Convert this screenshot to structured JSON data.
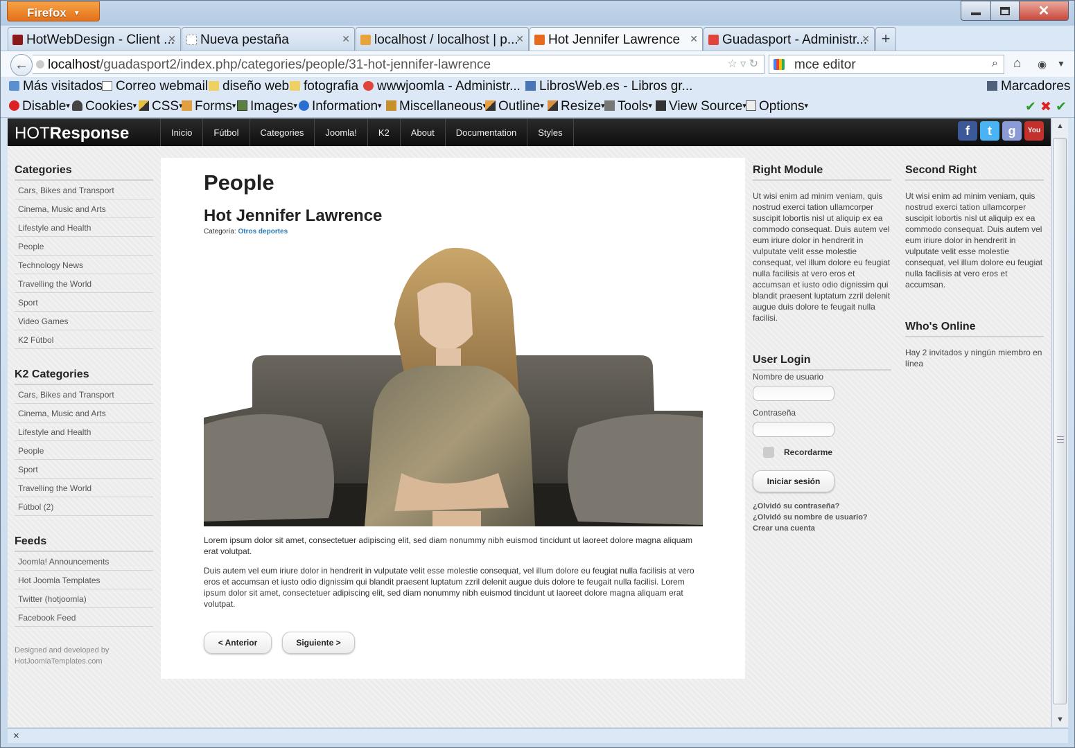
{
  "browser": {
    "app_button": "Firefox",
    "tabs": [
      {
        "title": "HotWebDesign - Client ...",
        "color": "#8b1a1a"
      },
      {
        "title": "Nueva pestaña",
        "color": "#ffffff"
      },
      {
        "title": "localhost / localhost | p...",
        "color": "#e8a33d"
      },
      {
        "title": "Hot Jennifer Lawrence",
        "color": "#e86a1e"
      },
      {
        "title": "Guadasport - Administr...",
        "color": "#e0443a"
      }
    ],
    "url_host": "localhost",
    "url_path": "/guadasport2/index.php/categories/people/31-hot-jennifer-lawrence",
    "search_value": "mce editor",
    "bookmarks": [
      "Más visitados",
      "Correo webmail",
      "diseño web",
      "fotografia",
      "wwwjoomla - Administr...",
      "LibrosWeb.es - Libros gr...",
      "Marcadores"
    ],
    "webdev_toolbar": [
      "Disable",
      "Cookies",
      "CSS",
      "Forms",
      "Images",
      "Information",
      "Miscellaneous",
      "Outline",
      "Resize",
      "Tools",
      "View Source",
      "Options"
    ],
    "status": "×"
  },
  "site": {
    "logo_light": "HOT",
    "logo_bold": "Response",
    "menu": [
      "Inicio",
      "Fútbol",
      "Categories",
      "Joomla!",
      "K2",
      "About",
      "Documentation",
      "Styles"
    ],
    "social": [
      "facebook-icon",
      "twitter-icon",
      "google-icon",
      "youtube-icon"
    ]
  },
  "sidebar": {
    "categories_title": "Categories",
    "categories": [
      "Cars, Bikes and Transport",
      "Cinema, Music and Arts",
      "Lifestyle and Health",
      "People",
      "Technology News",
      "Travelling the World",
      "Sport",
      "Video Games",
      "K2 Fútbol"
    ],
    "k2_title": "K2 Categories",
    "k2": [
      "Cars, Bikes and Transport",
      "Cinema, Music and Arts",
      "Lifestyle and Health",
      "People",
      "Sport",
      "Travelling the World",
      "Fútbol (2)"
    ],
    "feeds_title": "Feeds",
    "feeds": [
      "Joomla! Announcements",
      "Hot Joomla Templates",
      "Twitter (hotjoomla)",
      "Facebook Feed"
    ],
    "credit_line1": "Designed and developed by",
    "credit_line2": "HotJoomlaTemplates.com"
  },
  "article": {
    "page_heading": "People",
    "title": "Hot Jennifer Lawrence",
    "category_label": "Categoría:",
    "category_link": "Otros deportes",
    "para1": "Lorem ipsum dolor sit amet, consectetuer adipiscing elit, sed diam nonummy nibh euismod tincidunt ut laoreet dolore magna aliquam erat volutpat.",
    "para2": "Duis autem vel eum iriure dolor in hendrerit in vulputate velit esse molestie consequat, vel illum dolore eu feugiat nulla facilisis at vero eros et accumsan et iusto odio dignissim qui blandit praesent luptatum zzril delenit augue duis dolore te feugait nulla facilisi. Lorem ipsum dolor sit amet, consectetuer adipiscing elit, sed diam nonummy nibh euismod tincidunt ut laoreet dolore magna aliquam erat volutpat.",
    "prev": "< Anterior",
    "next": "Siguiente >"
  },
  "right": {
    "module_title": "Right Module",
    "module_text": "Ut wisi enim ad minim veniam, quis nostrud exerci tation ullamcorper suscipit lobortis nisl ut aliquip ex ea commodo consequat. Duis autem vel eum iriure dolor in hendrerit in vulputate velit esse molestie consequat, vel illum dolore eu feugiat nulla facilisis at vero eros et accumsan et iusto odio dignissim qui blandit praesent luptatum zzril delenit augue duis dolore te feugait nulla facilisi.",
    "login_title": "User Login",
    "username_label": "Nombre de usuario",
    "password_label": "Contraseña",
    "remember_label": "Recordarme",
    "login_button": "Iniciar sesión",
    "forgot_password": "¿Olvidó su contraseña?",
    "forgot_username": "¿Olvidó su nombre de usuario?",
    "create_account": "Crear una cuenta"
  },
  "second": {
    "title": "Second Right",
    "text": "Ut wisi enim ad minim veniam, quis nostrud exerci tation ullamcorper suscipit lobortis nisl ut aliquip ex ea commodo consequat. Duis autem vel eum iriure dolor in hendrerit in vulputate velit esse molestie consequat, vel illum dolore eu feugiat nulla facilisis at vero eros et accumsan.",
    "online_title": "Who's Online",
    "online_text": "Hay 2 invitados y ningún miembro en línea"
  }
}
